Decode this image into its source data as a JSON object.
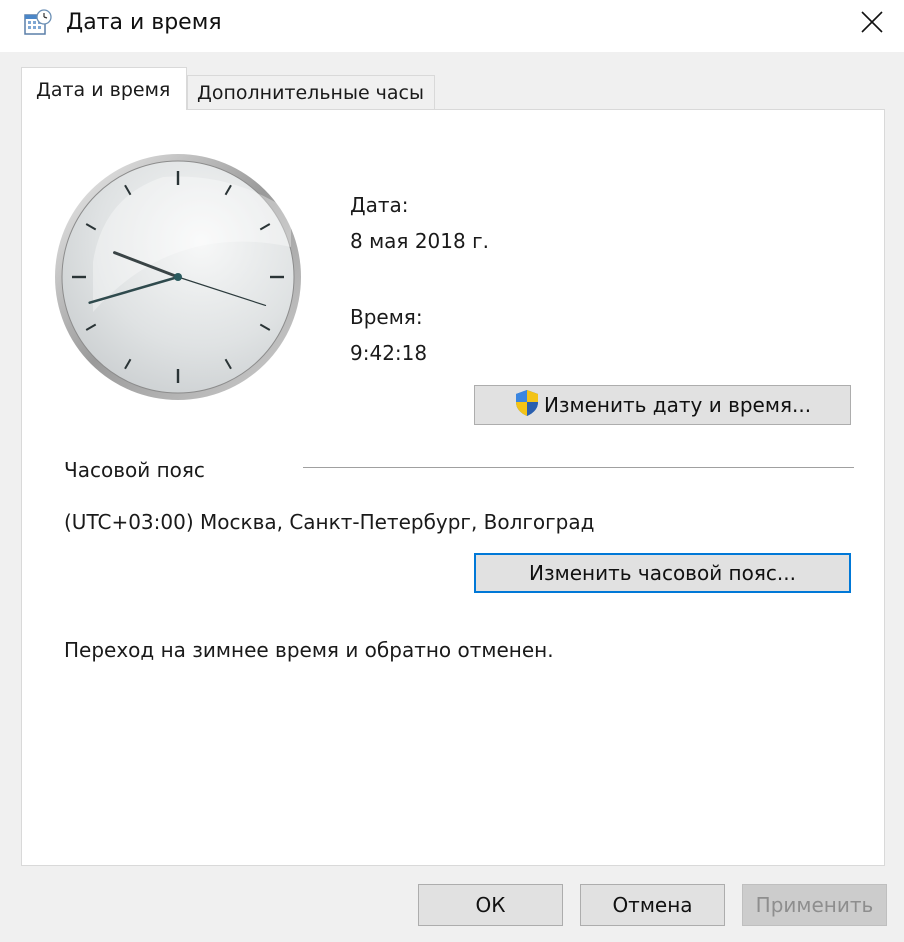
{
  "window": {
    "title": "Дата и время",
    "icon": "calendar-clock-icon",
    "close_icon": "close-icon"
  },
  "tabs": [
    {
      "label": "Дата и время",
      "active": true
    },
    {
      "label": "Дополнительные часы",
      "active": false
    }
  ],
  "clock": {
    "hour": 9,
    "minute": 42,
    "second": 18
  },
  "date": {
    "label": "Дата:",
    "value": "8 мая 2018 г."
  },
  "time": {
    "label": "Время:",
    "value": "9:42:18"
  },
  "change_datetime_button": {
    "label": "Изменить дату и время...",
    "icon": "uac-shield-icon"
  },
  "timezone": {
    "section_label": "Часовой пояс",
    "value": "(UTC+03:00) Москва, Санкт-Петербург, Волгоград",
    "change_button": "Изменить часовой пояс..."
  },
  "dst_note": "Переход на зимнее время и обратно отменен.",
  "footer": {
    "ok": "ОК",
    "cancel": "Отмена",
    "apply": "Применить"
  },
  "colors": {
    "accent": "#0078d7",
    "window_bg": "#f0f0f0",
    "panel_bg": "#ffffff"
  }
}
